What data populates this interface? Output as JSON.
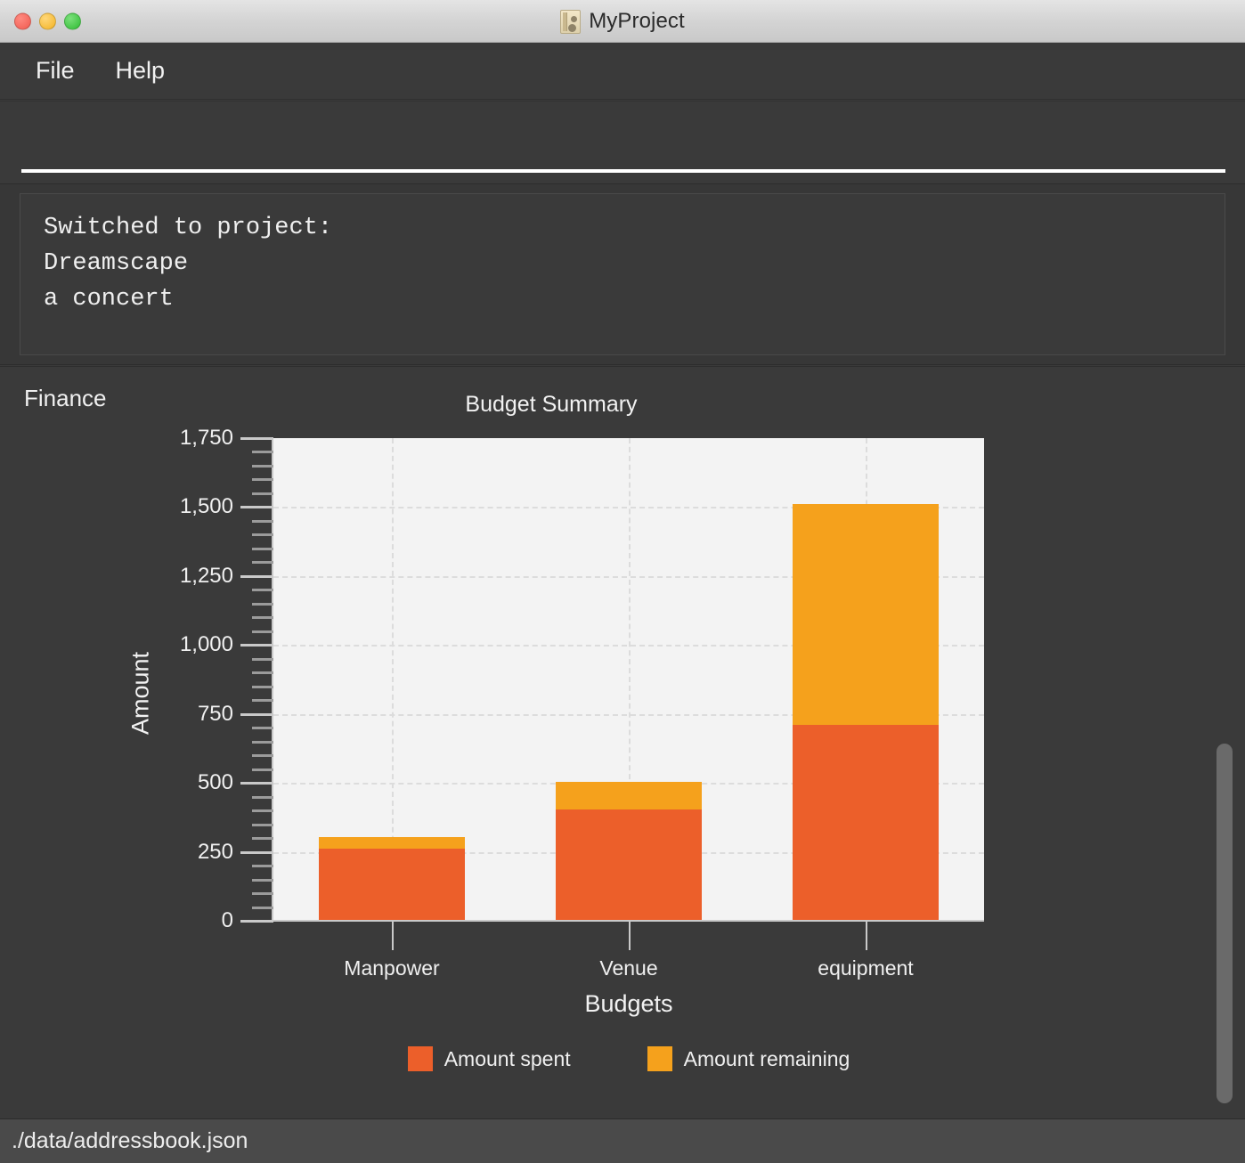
{
  "window": {
    "title": "MyProject",
    "icon": "addressbook-icon",
    "controls": [
      "close",
      "minimize",
      "zoom"
    ]
  },
  "menubar": {
    "items": [
      {
        "label": "File"
      },
      {
        "label": "Help"
      }
    ]
  },
  "command_input": {
    "value": "",
    "placeholder": ""
  },
  "log": {
    "lines": [
      "Switched to project:",
      "Dreamscape",
      "a concert"
    ]
  },
  "content": {
    "section_label": "Finance"
  },
  "statusbar": {
    "path": "./data/addressbook.json"
  },
  "colors": {
    "spent": "#EC5F2A",
    "remaining": "#F5A11C",
    "plot_background": "#F3F3F3",
    "app_background": "#3A3A3A",
    "grid": "#DCDCDC"
  },
  "chart_data": {
    "type": "bar",
    "stacked": true,
    "title": "Budget Summary",
    "xlabel": "Budgets",
    "ylabel": "Amount",
    "categories": [
      "Manpower",
      "Venue",
      "equipment"
    ],
    "series": [
      {
        "name": "Amount spent",
        "values": [
          260,
          405,
          710
        ],
        "color": "#EC5F2A"
      },
      {
        "name": "Amount remaining",
        "values": [
          45,
          100,
          800
        ],
        "color": "#F5A11C"
      }
    ],
    "totals": [
      305,
      505,
      1510
    ],
    "ylim": [
      0,
      1750
    ],
    "ytick_values": [
      0,
      250,
      500,
      750,
      1000,
      1250,
      1500,
      1750
    ],
    "ytick_labels": [
      "0",
      "250",
      "500",
      "750",
      "1,000",
      "1,250",
      "1,500",
      "1,750"
    ],
    "yminor_step": 50,
    "grid": true,
    "grid_style": "dashed",
    "legend_position": "bottom",
    "legend_entries": [
      "Amount spent",
      "Amount remaining"
    ]
  }
}
